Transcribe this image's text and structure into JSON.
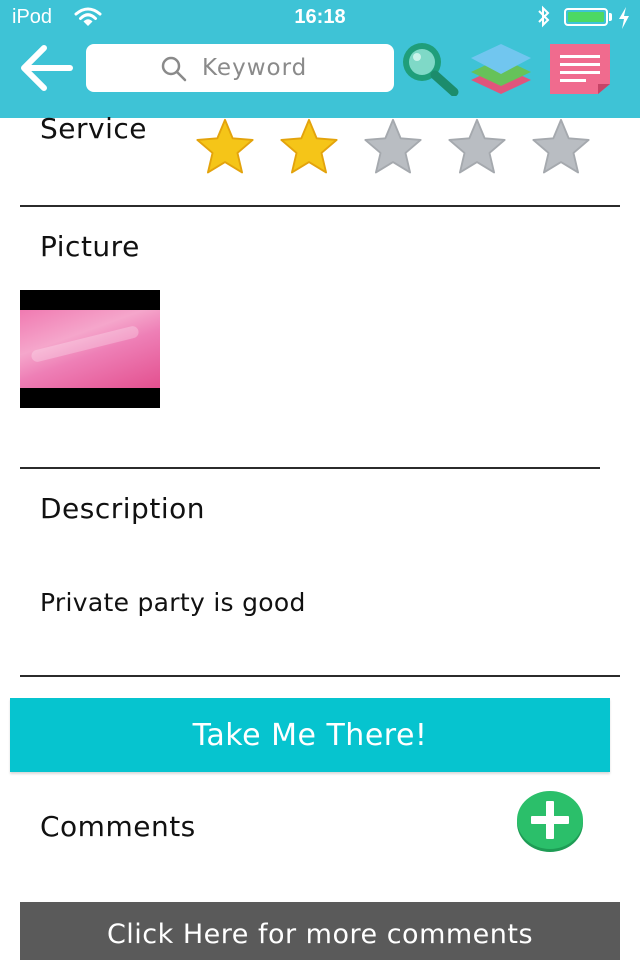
{
  "status_bar": {
    "device": "iPod",
    "time": "16:18",
    "battery_level": 1.0
  },
  "nav": {
    "back_icon": "back-arrow-icon",
    "search_placeholder": "Keyword",
    "search_value": "",
    "tools": [
      "search-magnifier-icon",
      "layers-icon",
      "notes-icon"
    ]
  },
  "rating": {
    "label": "Service",
    "value": 2,
    "max": 5
  },
  "picture": {
    "label": "Picture"
  },
  "description": {
    "label": "Description",
    "text": "Private party is good"
  },
  "cta": {
    "label": "Take Me There!"
  },
  "comments": {
    "label": "Comments",
    "add_icon": "plus-circle-icon",
    "more_label": "Click Here for more comments"
  },
  "colors": {
    "header": "#3ec3d6",
    "cta": "#06c4cf",
    "star_active": "#f5c518",
    "star_inactive": "#b9bdc2",
    "add_button": "#2bbf6a",
    "more_button": "#5a5a5a"
  }
}
